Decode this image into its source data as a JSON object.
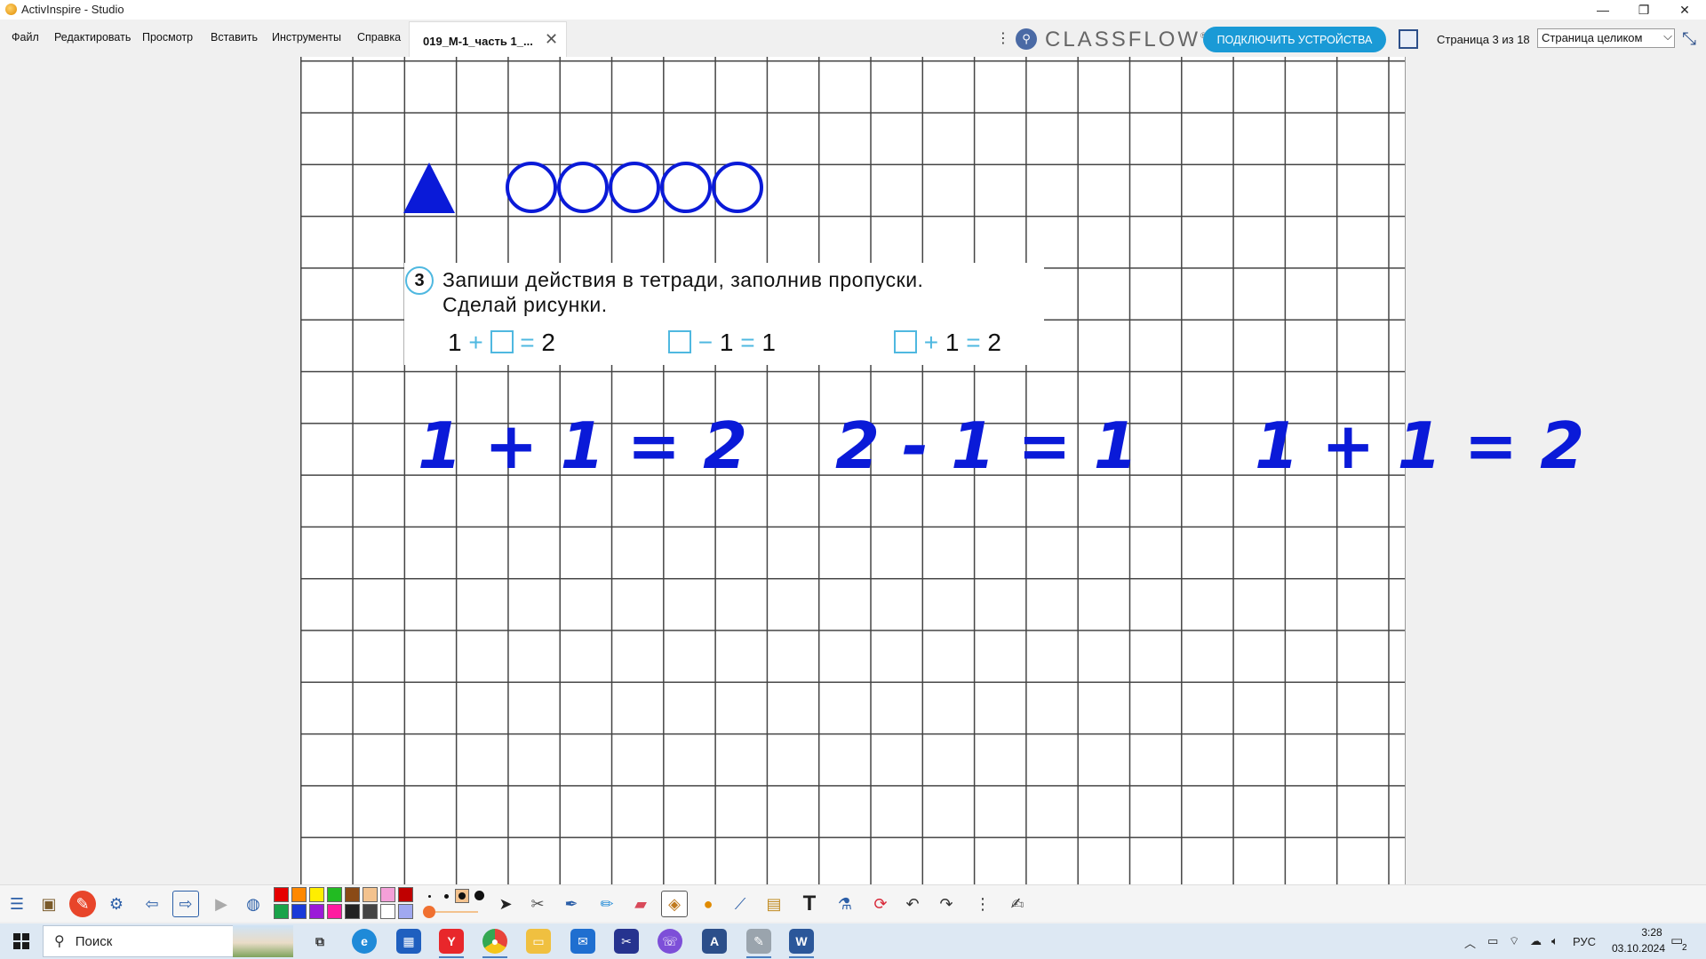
{
  "window": {
    "title": "ActivInspire - Studio",
    "minimize": "—",
    "restore": "❐",
    "close": "✕"
  },
  "menu": [
    "Файл",
    "Редактировать",
    "Просмотр",
    "Вставить",
    "Инструменты",
    "Справка"
  ],
  "document_tab": {
    "label": "019_М-1_часть 1_...",
    "close": "✕"
  },
  "classflow": {
    "logo": "CLASSFLOW",
    "trademark": "®",
    "connect_button": "ПОДКЛЮЧИТЬ УСТРОЙСТВА"
  },
  "pagination": {
    "label": "Страница 3 из 18",
    "current": 3,
    "total": 18
  },
  "zoom": {
    "selected": "Страница целиком"
  },
  "worksheet": {
    "task_number": "3",
    "instruction_line1": "Запиши действия в тетради, заполнив пропуски.",
    "instruction_line2": "Сделай рисунки.",
    "equations": [
      [
        "1",
        "+",
        "□",
        "=",
        "2"
      ],
      [
        "□",
        "−",
        "1",
        "=",
        "1"
      ],
      [
        "□",
        "+",
        "1",
        "=",
        "2"
      ]
    ],
    "handwritten": [
      "1 + 1 = 2",
      "2 - 1 = 1",
      "1 + 1 = 2"
    ],
    "shapes": {
      "triangles": 1,
      "circles": 5,
      "color": "#0a1ad8"
    }
  },
  "palette_colors": [
    "#e60000",
    "#ff8800",
    "#ffee00",
    "#22bb22",
    "#8a4a16",
    "#f3c28e",
    "#f4a0d8",
    "#c00000",
    "#1aa34a",
    "#1a3ad8",
    "#9b1ad8",
    "#ff1aa0",
    "#222222",
    "#444444",
    "#ffffff",
    "#a0a8f0"
  ],
  "taskbar": {
    "search_placeholder": "Поиск",
    "language": "РУС",
    "time": "3:28",
    "date": "03.10.2024",
    "notifications": "2"
  }
}
